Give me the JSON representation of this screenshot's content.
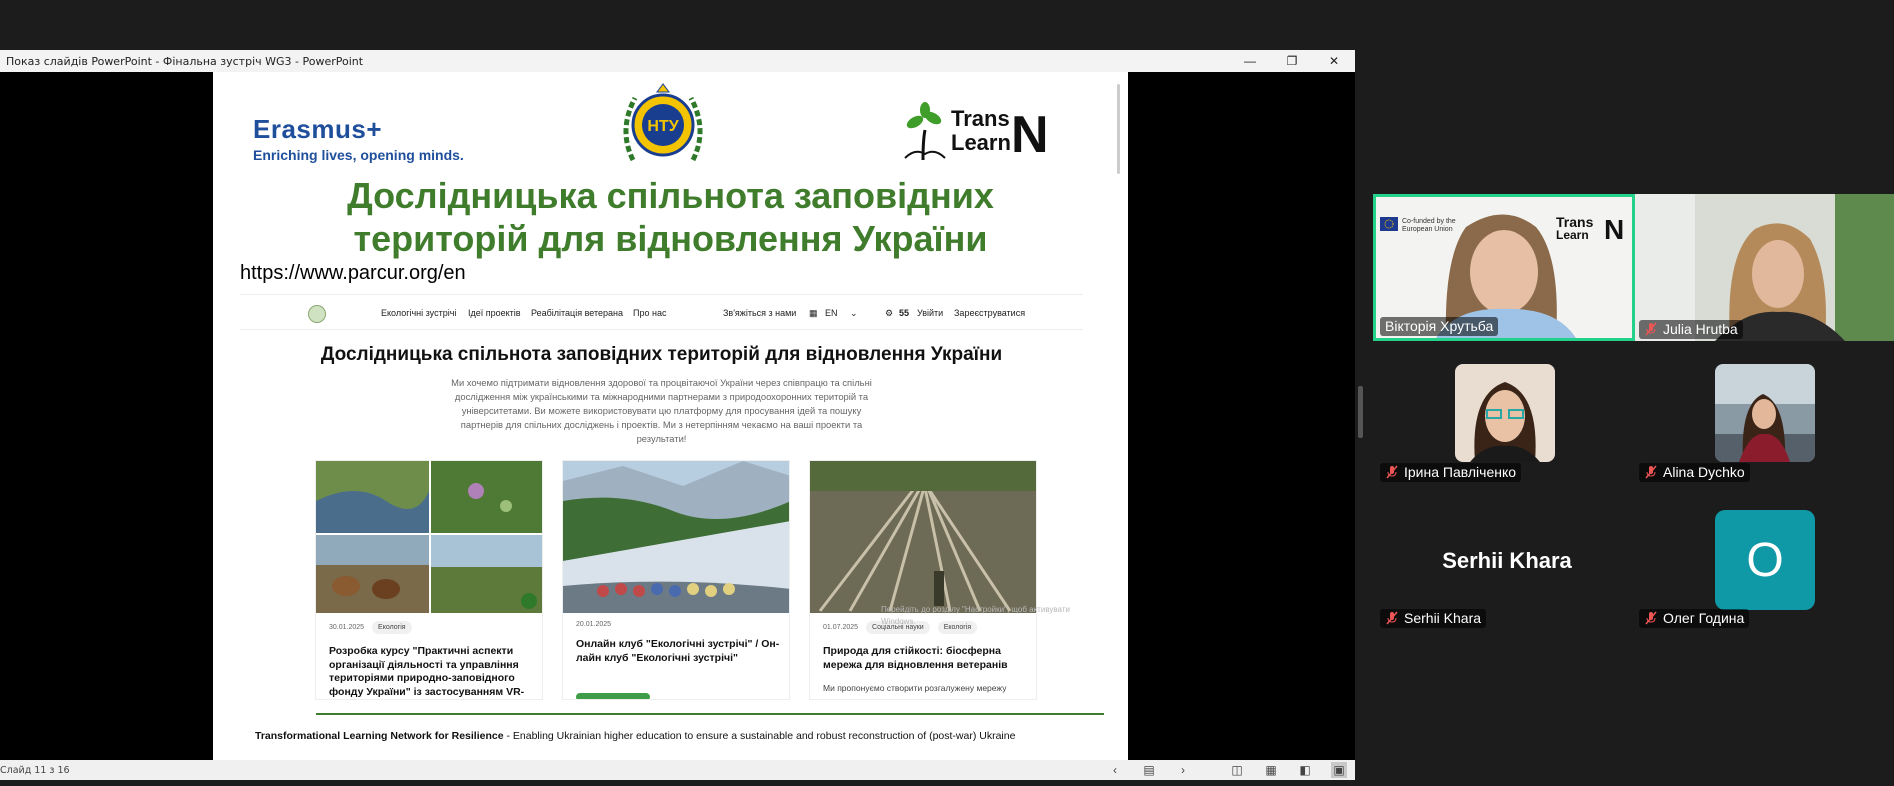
{
  "window": {
    "title": "Показ слайдів PowerPoint  -  Фінальна зустріч WG3 - PowerPoint",
    "minimize_icon": "minimize-icon",
    "restore_icon": "restore-icon",
    "close_icon": "close-icon"
  },
  "slide": {
    "erasmus_word": "Erasmus+",
    "erasmus_tagline": "Enriching lives, opening minds.",
    "ntu_logo_text": "НТУ",
    "transn_line1": "Trans",
    "transn_line2": "Learn",
    "transn_letter": "N",
    "title_line1": "Дослідницька спільнота заповідних",
    "title_line2": "територій для відновлення України",
    "url": "https://www.parcur.org/en",
    "footer_bold": "Transformational Learning Network for Resilience",
    "footer_rest": " - Enabling Ukrainian higher education to ensure a sustainable and robust reconstruction of (post-war) Ukraine",
    "accent_color": "#3f7d2c"
  },
  "site": {
    "nav": {
      "items": [
        "Екологічні зустрічі",
        "Ідеї проектів",
        "Реабілітація ветерана",
        "Про нас"
      ],
      "contact": "Зв'яжіться з нами",
      "lang": "EN",
      "count": "55",
      "login": "Увійти",
      "register": "Зареєструватися"
    },
    "heading": "Дослідницька спільнота заповідних територій для відновлення України",
    "description": "Ми хочемо підтримати відновлення здорової та процвітаючої України через співпрацю та спільні дослідження між українськими та міжнародними партнерами з природоохоронних територій та університетами. Ви можете використовувати цю платформу для просування ідей та пошуку партнерів для спільних досліджень і проектів. Ми з нетерпінням чекаємо на ваші проекти та результати!",
    "cards": [
      {
        "date": "30.01.2025",
        "tags": [
          "Екологія"
        ],
        "title": "Розробка курсу \"Практичні аспекти організації діяльності та управління територіями природно-заповідного фонду України\" із застосуванням VR-",
        "excerpt": ""
      },
      {
        "date": "20.01.2025",
        "tags": [],
        "title": "Онлайн клуб \"Екологічні зустрічі\" / Он-лайн клуб \"Екологічні зустрічі\"",
        "excerpt": ""
      },
      {
        "date": "01.07.2025",
        "tags": [
          "Соціальні науки",
          "Екологія"
        ],
        "title": "Природа для стійкості: біосферна мережа для відновлення ветеранів",
        "excerpt": "Ми пропонуємо створити розгалужену мережу"
      }
    ],
    "watermark_line1": "Перейдіть до розділу \"Настройки\", щоб активувати",
    "watermark_line2": "Windows."
  },
  "statusbar": {
    "slide_counter": "Слайд 11 з 16"
  },
  "participants": [
    {
      "name": "Вікторія Хрутьба",
      "muted": false,
      "speaking": true
    },
    {
      "name": "Julia Hrutba",
      "muted": true
    },
    {
      "name": "Ірина Павліченко",
      "muted": true
    },
    {
      "name": "Alina Dychko",
      "muted": true
    },
    {
      "name": "Serhii Khara",
      "muted": true,
      "display_name": "Serhii Khara"
    },
    {
      "name": "Олег Година",
      "muted": true,
      "initial": "О"
    }
  ],
  "tile_banner": {
    "eu_text_line1": "Co-funded by the",
    "eu_text_line2": "European Union"
  }
}
